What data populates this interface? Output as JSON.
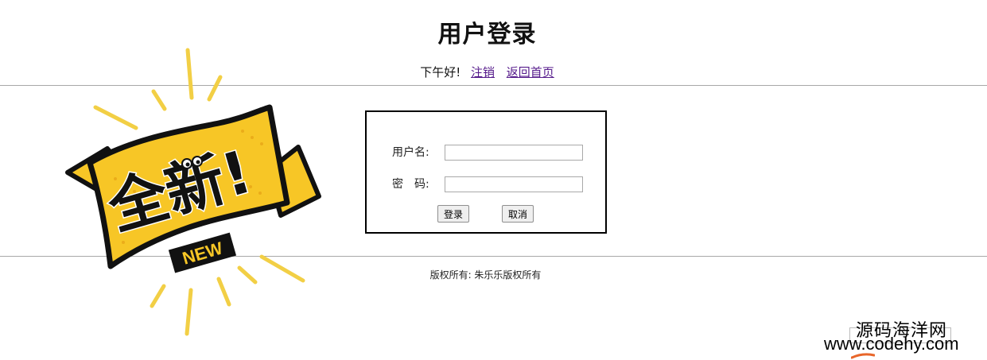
{
  "page": {
    "title": "用户登录",
    "greeting": "下午好!",
    "logout_link": "注销",
    "home_link": "返回首页"
  },
  "sticker": {
    "main_text": "全新!",
    "sub_text": "NEW",
    "colors": {
      "yellow": "#f7c626",
      "black": "#111111"
    }
  },
  "login_form": {
    "username_label": "用户名:",
    "username_value": "",
    "password_label": "密　码:",
    "password_value": "",
    "login_button": "登录",
    "cancel_button": "取消"
  },
  "footer": {
    "copyright": "版权所有: 朱乐乐版权所有"
  },
  "watermark": {
    "line1": "源码海洋网",
    "line2": "www.codehy.com"
  }
}
